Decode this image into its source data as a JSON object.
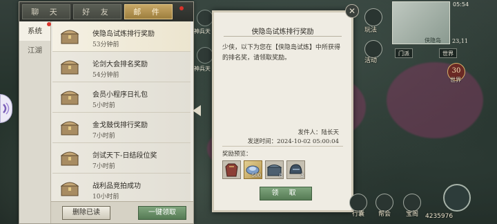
{
  "tabs": [
    {
      "label": "聊 天",
      "active": false
    },
    {
      "label": "好 友",
      "active": false
    },
    {
      "label": "邮 件",
      "active": true
    }
  ],
  "categories": [
    {
      "label": "系统",
      "active": true
    },
    {
      "label": "江湖",
      "active": false
    }
  ],
  "mails": [
    {
      "title": "侠隐岛试炼排行奖励",
      "time": "53分钟前"
    },
    {
      "title": "论剑大会排名奖励",
      "time": "54分钟前"
    },
    {
      "title": "会员小程序日礼包",
      "time": "5小时前"
    },
    {
      "title": "金戈鼓伐排行奖励",
      "time": "7小时前"
    },
    {
      "title": "剑试天下-日结段位奖",
      "time": "7小时前"
    },
    {
      "title": "战利品竞拍成功",
      "time": "10小时前"
    }
  ],
  "buttons": {
    "delete_read": "删除已读",
    "claim_all": "一键领取"
  },
  "detail": {
    "title": "侠隐岛试炼排行奖励",
    "body": "少侠，以下为您在【侠隐岛试炼】中所获得的排名奖，请领取奖励。",
    "sender": "发件人：陆长天",
    "send_time": "发送时间：2024-10-02 05:00:04",
    "preview_label": "奖励预览：",
    "rewards": [
      {
        "icon": "armor-chest-icon",
        "qty": ""
      },
      {
        "icon": "gold-ingot-icon",
        "qty": "500"
      },
      {
        "icon": "treasure-chest-icon",
        "qty": "8"
      },
      {
        "icon": "helmet-icon",
        "qty": "3"
      }
    ],
    "claim_label": "领 取"
  },
  "side": {
    "top_label": "神兵天",
    "mid_label": "神兵天"
  },
  "hud": {
    "time": "05:54",
    "wanfa": "玩法",
    "huodong": "活动",
    "menpai": "门派",
    "shijie": "世界",
    "map_label": "侠隐岛",
    "coords": "23,11",
    "badge_num": "30",
    "badge_text": "世界",
    "xingnang": "行囊",
    "bangpai": "帮会",
    "baoge": "宝阁",
    "currency": "4235976"
  },
  "colors": {
    "active_tab": "#c8a866",
    "claim_green": "#557a54",
    "red_dot": "#d8322a"
  }
}
